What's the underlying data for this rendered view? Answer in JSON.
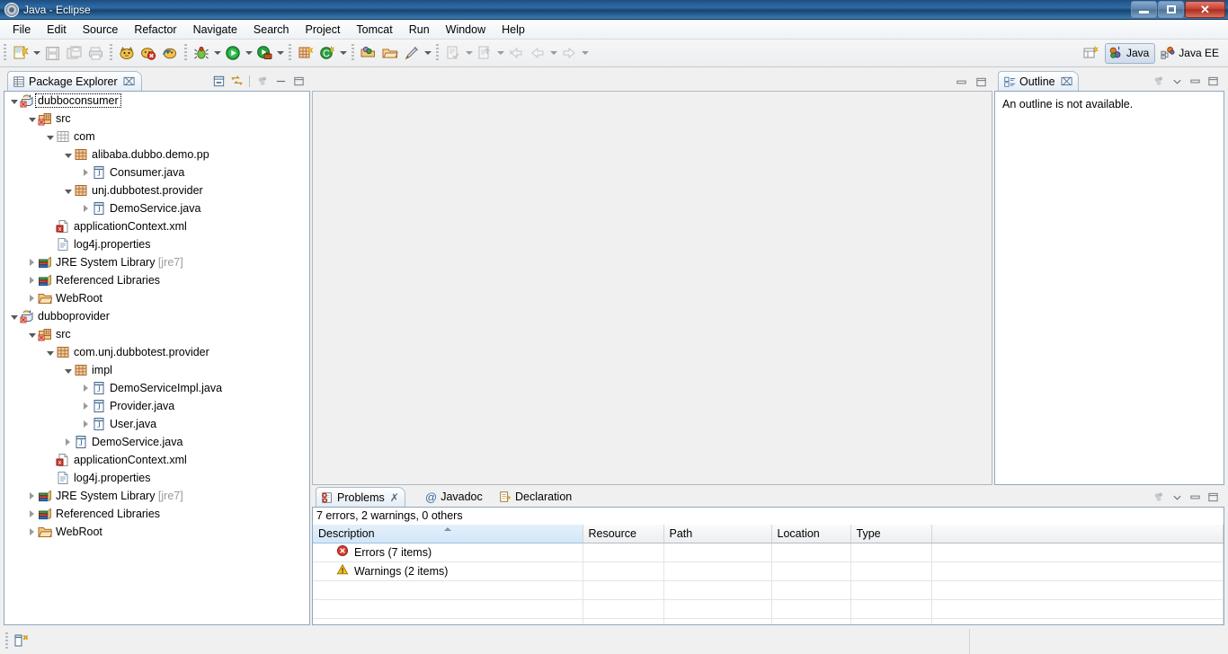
{
  "window": {
    "title": "Java - Eclipse",
    "app_icon": "eclipse-icon",
    "controls": {
      "minimize": "minimize-button",
      "maximize": "restore-button",
      "close": "close-button"
    }
  },
  "menubar": {
    "items": [
      "File",
      "Edit",
      "Source",
      "Refactor",
      "Navigate",
      "Search",
      "Project",
      "Tomcat",
      "Run",
      "Window",
      "Help"
    ]
  },
  "toolbar": {
    "groups": [
      {
        "buttons": [
          {
            "name": "new-wizard-icon",
            "dropdown": true
          },
          {
            "name": "save-icon",
            "dropdown": false,
            "disabled": true
          },
          {
            "name": "save-all-icon",
            "dropdown": false,
            "disabled": true
          },
          {
            "name": "print-icon",
            "dropdown": false,
            "disabled": true
          }
        ]
      },
      {
        "buttons": [
          {
            "name": "tomcat-start-icon",
            "dropdown": false
          },
          {
            "name": "tomcat-stop-icon",
            "dropdown": false
          },
          {
            "name": "tomcat-restart-icon",
            "dropdown": false
          }
        ]
      },
      {
        "buttons": [
          {
            "name": "debug-icon",
            "dropdown": true
          },
          {
            "name": "run-icon",
            "dropdown": true
          },
          {
            "name": "run-external-tools-icon",
            "dropdown": true
          }
        ]
      },
      {
        "buttons": [
          {
            "name": "new-java-package-icon",
            "dropdown": false
          },
          {
            "name": "new-java-class-icon",
            "dropdown": true
          }
        ]
      },
      {
        "buttons": [
          {
            "name": "open-type-icon",
            "dropdown": false
          },
          {
            "name": "open-task-icon",
            "dropdown": false
          },
          {
            "name": "search-icon",
            "dropdown": true
          }
        ]
      },
      {
        "buttons": [
          {
            "name": "next-annotation-icon",
            "dropdown": true,
            "disabled": true
          },
          {
            "name": "previous-annotation-icon",
            "dropdown": true,
            "disabled": true
          },
          {
            "name": "last-edit-location-icon",
            "dropdown": false,
            "disabled": true
          },
          {
            "name": "back-icon",
            "dropdown": true,
            "disabled": true
          },
          {
            "name": "forward-icon",
            "dropdown": true,
            "disabled": true
          }
        ]
      }
    ],
    "perspective": {
      "open_perspective": "open-perspective-icon",
      "active": "Java",
      "items": [
        "Java",
        "Java EE"
      ]
    }
  },
  "package_explorer": {
    "title": "Package Explorer",
    "close_label": "⌧",
    "toolbar": [
      "collapse-all-icon",
      "link-with-editor-icon",
      "view-menu-icon",
      "minimize-icon",
      "maximize-icon"
    ],
    "tree": [
      {
        "label": "dubboconsumer",
        "indent": 0,
        "twist": "open",
        "icon": "java-project-error-icon",
        "selected": true
      },
      {
        "label": "src",
        "indent": 1,
        "twist": "open",
        "icon": "source-folder-error-icon"
      },
      {
        "label": "com",
        "indent": 2,
        "twist": "open",
        "icon": "package-empty-icon"
      },
      {
        "label": "alibaba.dubbo.demo.pp",
        "indent": 3,
        "twist": "open",
        "icon": "package-icon"
      },
      {
        "label": "Consumer.java",
        "indent": 4,
        "twist": "closed",
        "icon": "java-file-icon"
      },
      {
        "label": "unj.dubbotest.provider",
        "indent": 3,
        "twist": "open",
        "icon": "package-icon"
      },
      {
        "label": "DemoService.java",
        "indent": 4,
        "twist": "closed",
        "icon": "java-file-icon"
      },
      {
        "label": "applicationContext.xml",
        "indent": 2,
        "twist": "none",
        "icon": "xml-error-icon"
      },
      {
        "label": "log4j.properties",
        "indent": 2,
        "twist": "none",
        "icon": "properties-file-icon"
      },
      {
        "label": "JRE System Library",
        "suffix": " [jre7]",
        "indent": 1,
        "twist": "closed",
        "icon": "library-icon"
      },
      {
        "label": "Referenced Libraries",
        "indent": 1,
        "twist": "closed",
        "icon": "library-icon"
      },
      {
        "label": "WebRoot",
        "indent": 1,
        "twist": "closed",
        "icon": "folder-icon"
      },
      {
        "label": "dubboprovider",
        "indent": 0,
        "twist": "open",
        "icon": "java-project-error-icon"
      },
      {
        "label": "src",
        "indent": 1,
        "twist": "open",
        "icon": "source-folder-error-icon"
      },
      {
        "label": "com.unj.dubbotest.provider",
        "indent": 2,
        "twist": "open",
        "icon": "package-icon"
      },
      {
        "label": "impl",
        "indent": 3,
        "twist": "open",
        "icon": "package-icon"
      },
      {
        "label": "DemoServiceImpl.java",
        "indent": 4,
        "twist": "closed",
        "icon": "java-file-icon"
      },
      {
        "label": "Provider.java",
        "indent": 4,
        "twist": "closed",
        "icon": "java-file-icon"
      },
      {
        "label": "User.java",
        "indent": 4,
        "twist": "closed",
        "icon": "java-file-icon"
      },
      {
        "label": "DemoService.java",
        "indent": 3,
        "twist": "closed",
        "icon": "java-file-icon"
      },
      {
        "label": "applicationContext.xml",
        "indent": 2,
        "twist": "none",
        "icon": "xml-error-icon"
      },
      {
        "label": "log4j.properties",
        "indent": 2,
        "twist": "none",
        "icon": "properties-file-icon"
      },
      {
        "label": "JRE System Library",
        "suffix": " [jre7]",
        "indent": 1,
        "twist": "closed",
        "icon": "library-icon"
      },
      {
        "label": "Referenced Libraries",
        "indent": 1,
        "twist": "closed",
        "icon": "library-icon"
      },
      {
        "label": "WebRoot",
        "indent": 1,
        "twist": "closed",
        "icon": "folder-icon"
      }
    ]
  },
  "editor_area": {
    "minimize": "minimize-icon",
    "maximize": "maximize-icon"
  },
  "outline": {
    "title": "Outline",
    "close_label": "⌧",
    "message": "An outline is not available.",
    "toolbar": [
      "view-menu-icon",
      "minimize-icon",
      "maximize-icon"
    ]
  },
  "problems": {
    "tabs": [
      {
        "label": "Problems",
        "icon": "problems-icon",
        "active": true,
        "closable": true
      },
      {
        "label": "Javadoc",
        "icon": "javadoc-icon",
        "active": false,
        "closable": false
      },
      {
        "label": "Declaration",
        "icon": "declaration-icon",
        "active": false,
        "closable": false
      }
    ],
    "summary": "7 errors, 2 warnings, 0 others",
    "columns": [
      "Description",
      "Resource",
      "Path",
      "Location",
      "Type"
    ],
    "sorted_column": "Description",
    "rows": [
      {
        "icon": "error-icon",
        "description": "Errors (7 items)",
        "resource": "",
        "path": "",
        "location": "",
        "type": ""
      },
      {
        "icon": "warning-icon",
        "description": "Warnings (2 items)",
        "resource": "",
        "path": "",
        "location": "",
        "type": ""
      }
    ],
    "empty_rows": 3,
    "toolbar": [
      "view-menu-icon",
      "minimize-icon",
      "maximize-icon"
    ]
  },
  "statusbar": {
    "icon": "editor-status-icon"
  },
  "colors": {
    "titlebar": "#2f6ba5",
    "accent": "#3c7cb4",
    "error": "#d23b2e",
    "warning": "#f0b400",
    "tab_active": "#eef3f8",
    "panel_border": "#8fa7bd"
  }
}
